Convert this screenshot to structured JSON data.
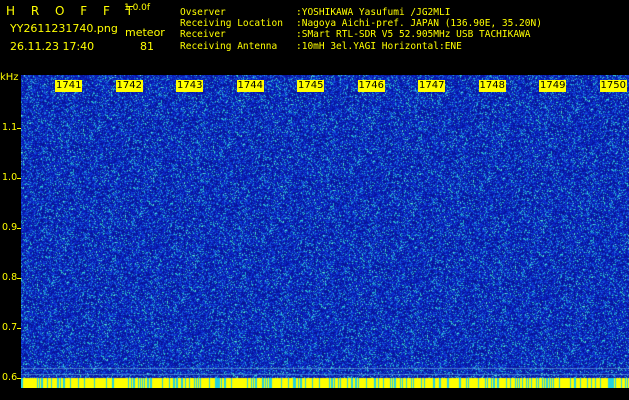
{
  "app": {
    "logo": "H R O F F T",
    "version": "1.0.0f",
    "filename": "YY2611231740.png",
    "datetime": "26.11.23 17:40",
    "category_label": "meteor",
    "count": "81"
  },
  "info": {
    "observer_label": "Ovserver",
    "observer_value": ":YOSHIKAWA Yasufumi /JG2MLI",
    "location_label": "Receiving Location",
    "location_value": ":Nagoya Aichi-pref. JAPAN (136.90E, 35.20N)",
    "receiver_label": "Receiver",
    "receiver_value": ":SMart RTL-SDR V5 52.905MHz USB TACHIKAWA",
    "antenna_label": "Receiving Antenna",
    "antenna_value": ":10mH 3el.YAGI Horizontal:ENE"
  },
  "axis": {
    "y_unit": "kHz",
    "y_ticks": [
      {
        "label": "1.1",
        "value": 1.1
      },
      {
        "label": "1.0",
        "value": 1.0
      },
      {
        "label": "0.9",
        "value": 0.9
      },
      {
        "label": "0.8",
        "value": 0.8
      },
      {
        "label": "0.7",
        "value": 0.7
      },
      {
        "label": "0.6",
        "value": 0.6
      }
    ],
    "x_ticks": [
      "1741",
      "1742",
      "1743",
      "1744",
      "1745",
      "1746",
      "1747",
      "1748",
      "1749",
      "1750"
    ]
  },
  "colors": {
    "text": "#ffff00",
    "background": "#000000",
    "spectrum_low": "#0a1fa8",
    "spectrum_high": "#2de0e0"
  }
}
